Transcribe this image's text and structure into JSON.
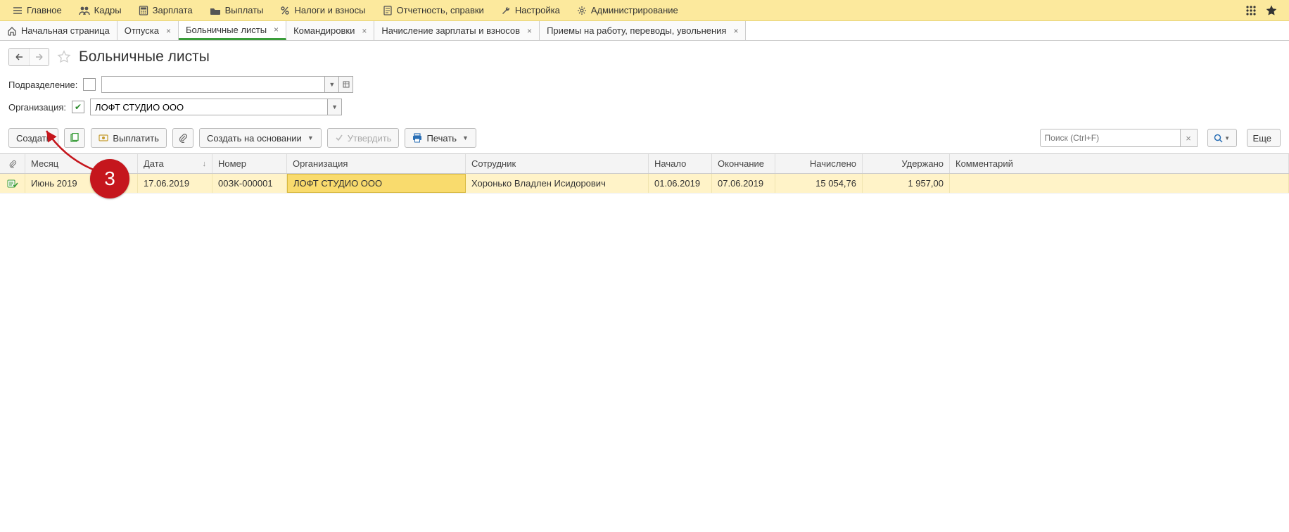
{
  "main_menu": {
    "items": [
      {
        "label": "Главное"
      },
      {
        "label": "Кадры"
      },
      {
        "label": "Зарплата"
      },
      {
        "label": "Выплаты"
      },
      {
        "label": "Налоги и взносы"
      },
      {
        "label": "Отчетность, справки"
      },
      {
        "label": "Настройка"
      },
      {
        "label": "Администрирование"
      }
    ]
  },
  "tabs": {
    "items": [
      {
        "label": "Начальная страница",
        "closable": false
      },
      {
        "label": "Отпуска",
        "closable": true
      },
      {
        "label": "Больничные листы",
        "closable": true,
        "active": true
      },
      {
        "label": "Командировки",
        "closable": true
      },
      {
        "label": "Начисление зарплаты и взносов",
        "closable": true
      },
      {
        "label": "Приемы на работу, переводы, увольнения",
        "closable": true
      }
    ]
  },
  "page": {
    "title": "Больничные листы"
  },
  "filters": {
    "department_label": "Подразделение:",
    "department_checked": false,
    "department_value": "",
    "org_label": "Организация:",
    "org_checked": true,
    "org_value": "ЛОФТ СТУДИО ООО"
  },
  "toolbar": {
    "create": "Создать",
    "pay": "Выплатить",
    "create_based": "Создать на основании",
    "approve": "Утвердить",
    "print": "Печать",
    "search_placeholder": "Поиск (Ctrl+F)",
    "more": "Еще"
  },
  "grid": {
    "columns": {
      "month": "Месяц",
      "date": "Дата",
      "number": "Номер",
      "org": "Организация",
      "emp": "Сотрудник",
      "start": "Начало",
      "end": "Окончание",
      "accr": "Начислено",
      "hold": "Удержано",
      "comment": "Комментарий"
    },
    "rows": [
      {
        "month": "Июнь 2019",
        "date": "17.06.2019",
        "number": "00ЗК-000001",
        "org": "ЛОФТ СТУДИО ООО",
        "emp": "Хоронько Владлен Исидорович",
        "start": "01.06.2019",
        "end": "07.06.2019",
        "accr": "15 054,76",
        "hold": "1 957,00",
        "comment": ""
      }
    ]
  },
  "annotation": {
    "badge": "3"
  }
}
